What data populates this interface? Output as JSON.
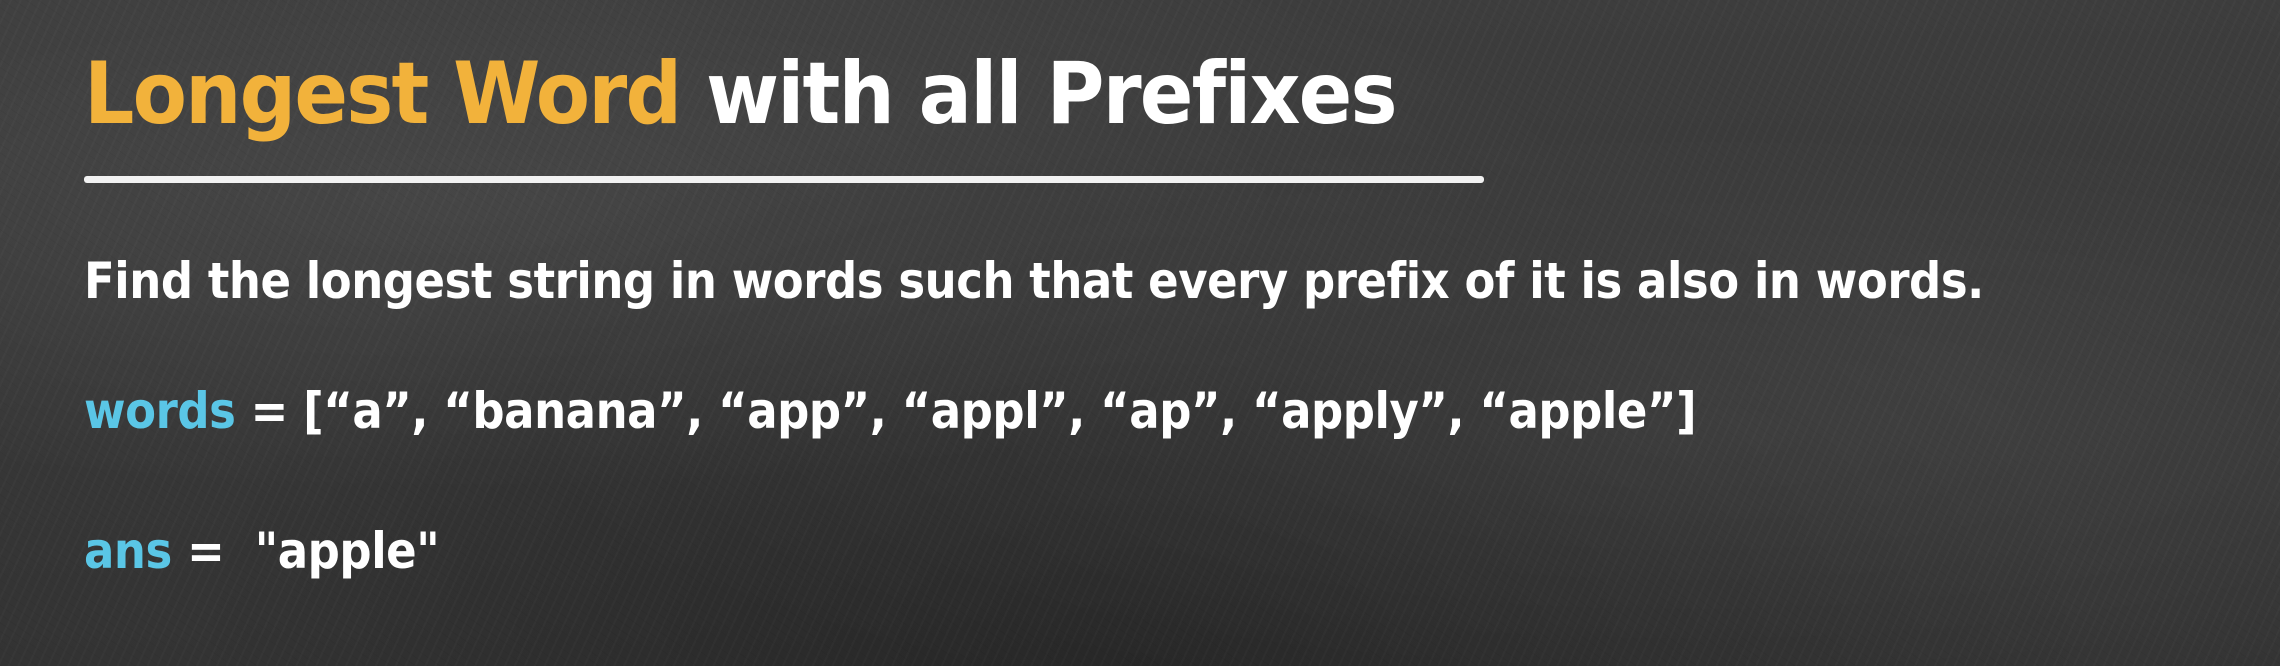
{
  "title": {
    "accent": "Longest Word",
    "rest": " with all Prefixes"
  },
  "description": "Find the longest string in words such that every prefix of it is also in words.",
  "words_line": {
    "var": "words",
    "op": " = ",
    "value": "[“a”, “banana”, “app”, “appl”, “ap”, “apply”, “apple”]"
  },
  "ans_line": {
    "var": "ans",
    "op": " =  ",
    "value": "\"apple\""
  },
  "colors": {
    "background": "#3b3b3b",
    "accent_orange": "#f2b23b",
    "variable_blue": "#5ac6e6",
    "text_white": "#ffffff"
  }
}
